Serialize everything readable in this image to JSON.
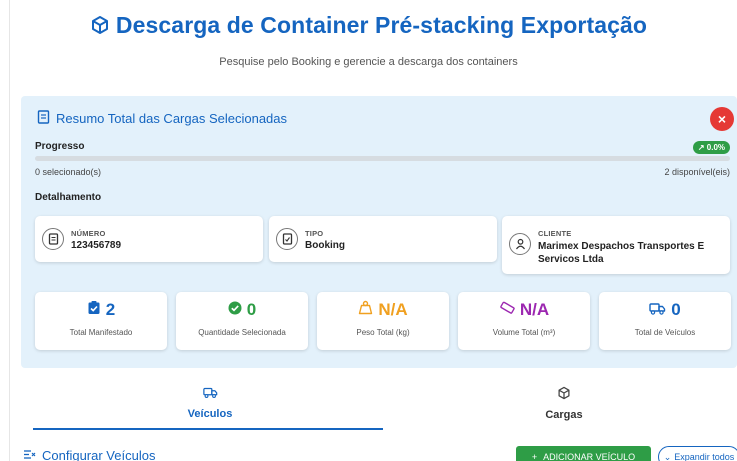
{
  "header": {
    "title": "Descarga de Container Pré-stacking Exportação",
    "subtitle": "Pesquise pelo Booking e gerencie a descarga dos containers"
  },
  "summary": {
    "title": "Resumo Total das Cargas Selecionadas",
    "progress_label": "Progresso",
    "progress_badge": "0.0%",
    "progress_value": 0.0,
    "selected_text": "0 selecionado(s)",
    "available_text": "2 disponível(eis)",
    "detail_label": "Detalhamento",
    "cards": {
      "numero_tag": "NÚMERO",
      "numero_value": "123456789",
      "tipo_tag": "TIPO",
      "tipo_value": "Booking",
      "cliente_tag": "CLIENTE",
      "cliente_value": "Marimex Despachos Transportes E Servicos Ltda"
    },
    "stats": [
      {
        "value": "2",
        "label": "Total Manifestado",
        "color": "#1565c0",
        "icon": "clipboard-check-icon"
      },
      {
        "value": "0",
        "label": "Quantidade Selecionada",
        "color": "#2e9d46",
        "icon": "check-circle-icon"
      },
      {
        "value": "N/A",
        "label": "Peso Total (kg)",
        "color": "#f0a020",
        "icon": "weight-icon"
      },
      {
        "value": "N/A",
        "label": "Volume Total (m³)",
        "color": "#9c27b0",
        "icon": "ruler-icon"
      },
      {
        "value": "0",
        "label": "Total de Veículos",
        "color": "#1565c0",
        "icon": "truck-icon"
      }
    ]
  },
  "tabs": [
    {
      "label": "Veículos",
      "icon": "truck-icon",
      "active": true
    },
    {
      "label": "Cargas",
      "icon": "cube-icon",
      "active": false
    }
  ],
  "section": {
    "title": "Configurar Veículos",
    "add_button": "ADICIONAR VEÍCULO",
    "expand_button": "Expandir todos"
  },
  "colors": {
    "primary": "#1565c0",
    "success": "#2e9d46",
    "danger": "#e53935",
    "summary_bg": "#e3f1fb"
  }
}
